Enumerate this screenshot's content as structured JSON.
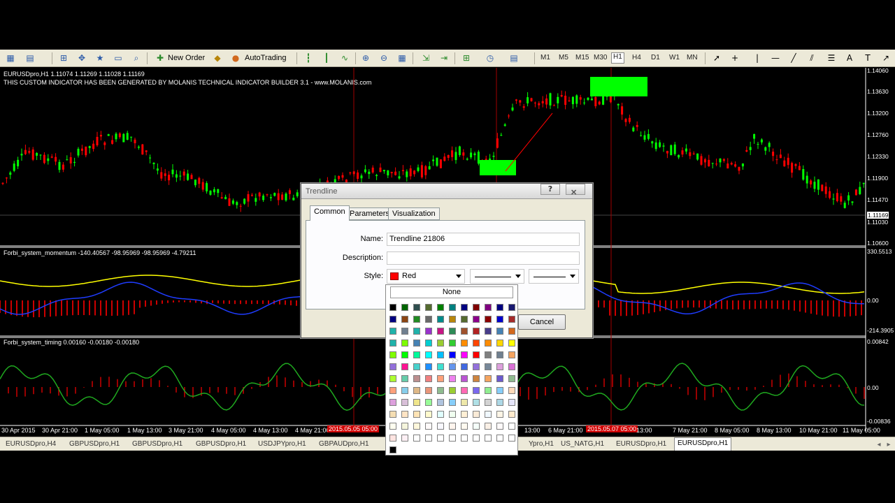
{
  "toolbar": {
    "new_order_label": "New Order",
    "autotrading_label": "AutoTrading",
    "timeframes": [
      "M1",
      "M5",
      "M15",
      "M30",
      "H1",
      "H4",
      "D1",
      "W1",
      "MN"
    ],
    "active_timeframe": "H1"
  },
  "chart": {
    "symbol_info": "EURUSDpro,H1  1.11074 1.11269 1.11028 1.11169",
    "banner": "THIS CUSTOM INDICATOR HAS BEEN GENERATED BY MOLANIS TECHNICAL INDICATOR BUILDER 3.1 - www.MOLANIS.com",
    "prices": [
      "1.14060",
      "1.13630",
      "1.13200",
      "1.12760",
      "1.12330",
      "1.11900",
      "1.11470",
      "1.11169",
      "1.11030",
      "1.10600"
    ],
    "bid_price": "1.11169",
    "momentum_label": "Forbi_system_momentum -140.40567 -98.95969 -98.95969 -4.79211",
    "momentum_scale": [
      "330.5513",
      "0.00",
      "-214.3905"
    ],
    "timing_label": "Forbi_system_timing 0.00160 -0.00180 -0.00180",
    "timing_scale": [
      "0.00842",
      "0.00",
      "-0.00836"
    ],
    "time_labels": [
      "30 Apr 2015",
      "30 Apr 21:00",
      "1 May 05:00",
      "1 May 13:00",
      "3 May 21:00",
      "4 May 05:00",
      "4 May 13:00",
      "4 May 21:00",
      "13:00",
      "6 May 21:00",
      "7 May 21:00",
      "8 May 05:00",
      "8 May 13:00",
      "10 May 21:00",
      "11 May 05:00"
    ],
    "highlighted_times": [
      "2015.05.05 05:00",
      "2015.05.07 05:00",
      "13:00"
    ],
    "colors": {
      "bull": "#00ff00",
      "bear": "#ff0000",
      "yellow": "#ffff00",
      "blue": "#1f3cff",
      "green": "#1fa81f"
    }
  },
  "tabs": [
    "EURUSDpro,H4",
    "GBPUSDpro,H1",
    "GBPUSDpro,H1",
    "GBPUSDpro,H1",
    "USDJPYpro,H1",
    "GBPAUDpro,H1",
    "...",
    "Ypro,H1",
    "US_NATG,H1",
    "EURUSDpro,H1",
    "EURUSDpro,H1"
  ],
  "active_tab": "EURUSDpro,H1",
  "dialog": {
    "title": "Trendline",
    "help": "?",
    "close": "✕",
    "tabs": [
      "Common",
      "Parameters",
      "Visualization"
    ],
    "active_tab": "Common",
    "name_label": "Name:",
    "name_value": "Trendline 21806",
    "description_label": "Description:",
    "description_value": "",
    "style_label": "Style:",
    "color_value": "Red",
    "color_hex": "#ff0000",
    "cancel": "Cancel"
  },
  "palette": {
    "none_label": "None",
    "rows": [
      [
        "#000000",
        "#006400",
        "#2f4f4f",
        "#556b2f",
        "#008000",
        "#008080",
        "#000080",
        "#800000",
        "#800080",
        "#000080",
        "#191970"
      ],
      [
        "#000080",
        "#8b4513",
        "#228b22",
        "#696969",
        "#008b8b",
        "#b8860b",
        "#556b2f",
        "#8b008b",
        "#8b0000",
        "#0000cd",
        "#a52a2a"
      ],
      [
        "#20b2aa",
        "#708090",
        "#20b2aa",
        "#9932cc",
        "#c71585",
        "#2e8b57",
        "#a0522d",
        "#b22222",
        "#483d8b",
        "#4682b4",
        "#d2691e"
      ],
      [
        "#20b2aa",
        "#7cfc00",
        "#4682b4",
        "#00ced1",
        "#9acd32",
        "#32cd32",
        "#ff8c00",
        "#ff4500",
        "#ff8c00",
        "#ffd700",
        "#ffff00"
      ],
      [
        "#7fff00",
        "#00ff00",
        "#00fa9a",
        "#00ffff",
        "#00bfff",
        "#0000ff",
        "#ff00ff",
        "#ff0000",
        "#808080",
        "#708090",
        "#f4a460"
      ],
      [
        "#9370db",
        "#ff1493",
        "#48d1cc",
        "#1e90ff",
        "#40e0d0",
        "#6495ed",
        "#4169e1",
        "#9370db",
        "#778899",
        "#dda0dd",
        "#da70d6"
      ],
      [
        "#adff2f",
        "#66cdaa",
        "#bc8f8f",
        "#f08080",
        "#ffa07a",
        "#ee82ee",
        "#ba55d3",
        "#cd853f",
        "#f4a460",
        "#6a5acd",
        "#8fbc8f"
      ],
      [
        "#ffa07a",
        "#87ceeb",
        "#deb887",
        "#e9967a",
        "#8fbc8f",
        "#9acd32",
        "#ff69b4",
        "#7b68ee",
        "#90ee90",
        "#87cefa",
        "#ffdab9"
      ],
      [
        "#dda0dd",
        "#d8bfd8",
        "#f0e68c",
        "#98fb98",
        "#b0c4de",
        "#87cefa",
        "#eee8aa",
        "#b0e0e6",
        "#d3d3d3",
        "#add8e6",
        "#e6e6fa"
      ],
      [
        "#f5deb3",
        "#ffe4c4",
        "#ffe4b5",
        "#fffacd",
        "#e0ffff",
        "#f0fff0",
        "#ffefd5",
        "#faebd7",
        "#f0f8ff",
        "#fdf5e6",
        "#ffebcd"
      ],
      [
        "#fffff0",
        "#f5f5dc",
        "#fff8dc",
        "#fffafa",
        "#f8f8ff",
        "#fff5ee",
        "#fffaf0",
        "#f5fffa",
        "#faf0e6",
        "#fffafa",
        "#ffffff"
      ],
      [
        "#ffe4e1",
        "#fff0f5",
        "#ffffff",
        "#ffffff",
        "#ffffff",
        "#ffffff",
        "#ffffff",
        "#ffffff",
        "#ffffff",
        "#ffffff",
        "#ffffff"
      ]
    ],
    "custom": "#000000"
  }
}
